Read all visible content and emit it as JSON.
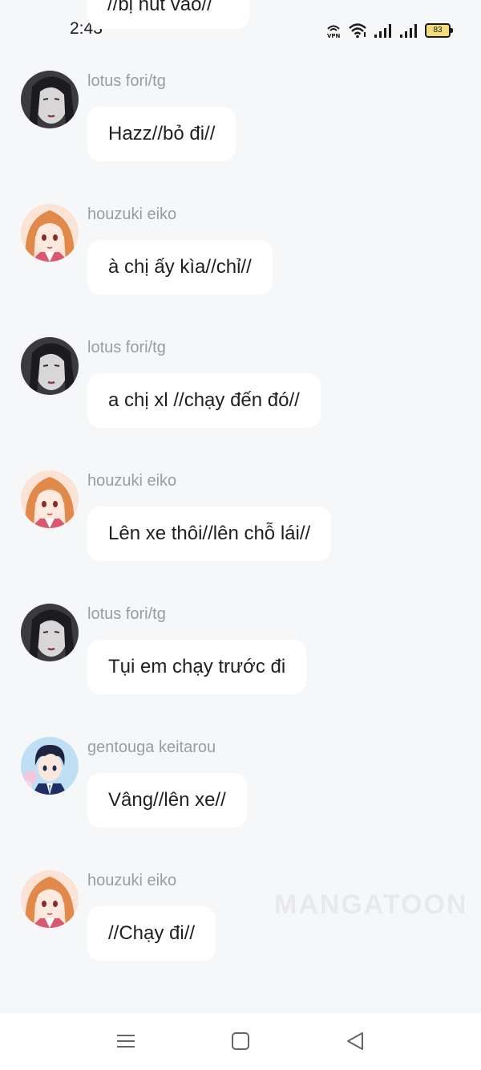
{
  "status_bar": {
    "time": "2:43",
    "icons": [
      "vpn-icon",
      "wifi-icon",
      "signal-icon",
      "signal-icon"
    ],
    "battery_level": "83"
  },
  "top_partial_message": {
    "text": "//bị hút vào//"
  },
  "messages": [
    {
      "sender": "lotus fori/tg",
      "text": "Hazz//bỏ đi//",
      "avatar": "dark-hair-girl"
    },
    {
      "sender": "houzuki eiko",
      "text": "à chị ấy kìa//chỉ//",
      "avatar": "orange-hair-girl"
    },
    {
      "sender": "lotus fori/tg",
      "text": "a chị xl //chạy đến đó//",
      "avatar": "dark-hair-girl"
    },
    {
      "sender": "houzuki eiko",
      "text": "Lên xe thôi//lên chỗ lái//",
      "avatar": "orange-hair-girl"
    },
    {
      "sender": "lotus fori/tg",
      "text": "Tụi em chạy trước đi",
      "avatar": "dark-hair-girl"
    },
    {
      "sender": "gentouga keitarou",
      "text": "Vâng//lên xe//",
      "avatar": "dark-hair-boy"
    },
    {
      "sender": "houzuki eiko",
      "text": "//Chạy đi//",
      "avatar": "orange-hair-girl"
    }
  ],
  "watermark": "MANGATOON",
  "nav_bar": {
    "buttons": [
      "menu-icon",
      "home-icon",
      "back-icon"
    ]
  }
}
